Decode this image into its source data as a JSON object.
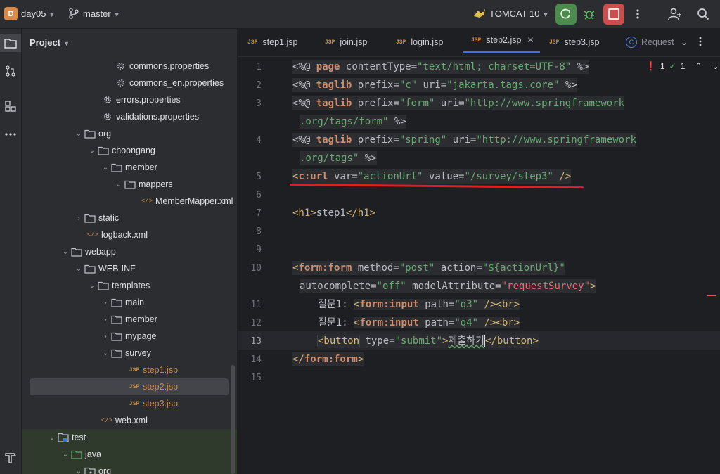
{
  "topbar": {
    "project_initial": "D",
    "project_name": "day05",
    "branch_name": "master",
    "run_config": "TOMCAT 10"
  },
  "panel": {
    "title": "Project",
    "tree": [
      {
        "label": "commons.properties",
        "icon": "gear-icon"
      },
      {
        "label": "commons_en.properties",
        "icon": "gear-icon"
      },
      {
        "label": "errors.properties",
        "icon": "gear-icon"
      },
      {
        "label": "validations.properties",
        "icon": "gear-icon"
      },
      {
        "label": "org",
        "icon": "folder-icon"
      },
      {
        "label": "choongang",
        "icon": "folder-icon"
      },
      {
        "label": "member",
        "icon": "folder-icon"
      },
      {
        "label": "mappers",
        "icon": "folder-icon"
      },
      {
        "label": "MemberMapper.xml",
        "icon": "xml-icon"
      },
      {
        "label": "static",
        "icon": "folder-icon"
      },
      {
        "label": "logback.xml",
        "icon": "xml-icon"
      },
      {
        "label": "webapp",
        "icon": "folder-icon"
      },
      {
        "label": "WEB-INF",
        "icon": "folder-icon"
      },
      {
        "label": "templates",
        "icon": "folder-icon"
      },
      {
        "label": "main",
        "icon": "folder-icon"
      },
      {
        "label": "member",
        "icon": "folder-icon"
      },
      {
        "label": "mypage",
        "icon": "folder-icon"
      },
      {
        "label": "survey",
        "icon": "folder-icon"
      },
      {
        "label": "step1.jsp",
        "icon": "jsp-icon"
      },
      {
        "label": "step2.jsp",
        "icon": "jsp-icon"
      },
      {
        "label": "step3.jsp",
        "icon": "jsp-icon"
      },
      {
        "label": "web.xml",
        "icon": "xml-icon"
      },
      {
        "label": "test",
        "icon": "module-folder-icon"
      },
      {
        "label": "java",
        "icon": "folder-icon"
      },
      {
        "label": "org",
        "icon": "folder-icon"
      }
    ],
    "file_type_label": "JSP"
  },
  "tabs": [
    {
      "label": "step1.jsp"
    },
    {
      "label": "join.jsp"
    },
    {
      "label": "login.jsp"
    },
    {
      "label": "step2.jsp",
      "active": true
    },
    {
      "label": "step3.jsp"
    },
    {
      "label": "Request"
    }
  ],
  "inspections": {
    "errors": "1",
    "warnings": "1"
  },
  "editor": {
    "line_numbers": [
      "1",
      "2",
      "3",
      "4",
      "5",
      "6",
      "7",
      "8",
      "9",
      "10",
      "11",
      "12",
      "13",
      "14",
      "15"
    ],
    "l1": {
      "open": "<%@",
      "kw": "page",
      "attr": "contentType=",
      "val": "\"text/html; charset=UTF-8\"",
      "close": "%>"
    },
    "l2": {
      "open": "<%@",
      "kw": "taglib",
      "a1": "prefix=",
      "v1": "\"c\"",
      "a2": "uri=",
      "v2": "\"jakarta.tags.core\"",
      "close": "%>"
    },
    "l3": {
      "open": "<%@",
      "kw": "taglib",
      "a1": "prefix=",
      "v1": "\"form\"",
      "a2": "uri=",
      "v2a": "\"http://www.springframework",
      "v2b": ".org/tags/form\"",
      "close": "%>"
    },
    "l4": {
      "open": "<%@",
      "kw": "taglib",
      "a1": "prefix=",
      "v1": "\"spring\"",
      "a2": "uri=",
      "v2a": "\"http://www.springframework",
      "v2b": ".org/tags\"",
      "close": "%>"
    },
    "l5": {
      "lt": "<",
      "tag": "c:url",
      "a1": "var=",
      "v1": "\"actionUrl\"",
      "a2": "value=",
      "v2": "\"/survey/step3\"",
      "close": "/>"
    },
    "l7": {
      "open": "<h1>",
      "text": "step1",
      "close": "</h1>"
    },
    "l10": {
      "lt": "<",
      "tag": "form:form",
      "a1": "method=",
      "v1": "\"post\"",
      "a2": "action=",
      "v2": "\"${actionUrl}\"",
      "a3": "autocomplete=",
      "v3": "\"off\"",
      "a4": "modelAttribute=",
      "v4": "\"requestSurvey\"",
      "gt": ">"
    },
    "l11": {
      "text": "질문1: ",
      "lt": "<",
      "tag": "form:input",
      "a1": "path=",
      "v1": "\"q3\"",
      "close": "/>",
      "br": "<br>"
    },
    "l12": {
      "text": "질문1: ",
      "lt": "<",
      "tag": "form:input",
      "a1": "path=",
      "v1": "\"q4\"",
      "close": "/>",
      "br": "<br>"
    },
    "l13": {
      "open": "<button",
      "a1": "type=",
      "v1": "\"submit\"",
      "gt": ">",
      "text": "제출하기",
      "close": "</button>"
    },
    "l14": {
      "lt": "</",
      "tag": "form:form",
      "gt": ">"
    }
  },
  "colors": {
    "accent": "#3574f0",
    "run": "#4c8a4e",
    "stop": "#c94f4f",
    "annotation": "#e02020"
  }
}
